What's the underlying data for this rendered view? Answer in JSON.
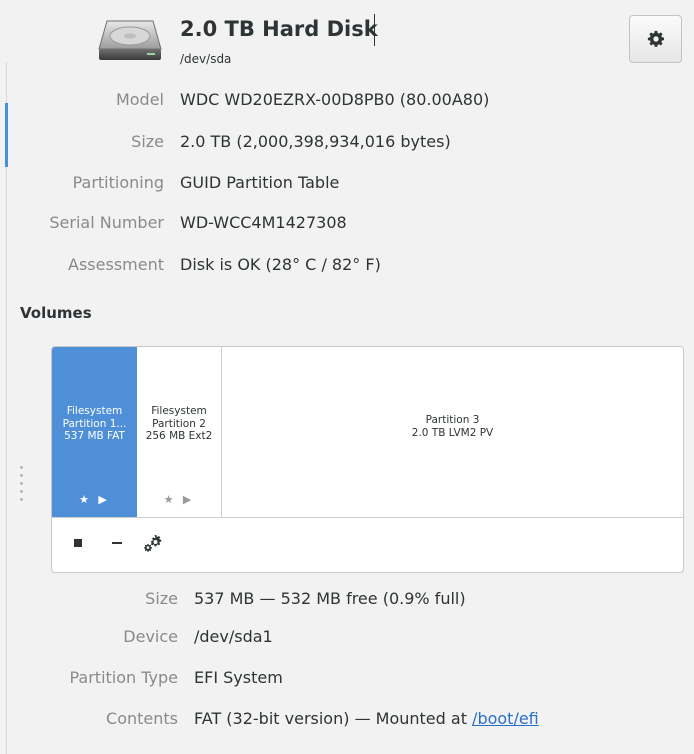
{
  "header": {
    "title": "2.0 TB Hard Disk",
    "device": "/dev/sda",
    "settings_icon": "gear-icon"
  },
  "drive_info": [
    {
      "label": "Model",
      "value": "WDC WD20EZRX-00D8PB0 (80.00A80)"
    },
    {
      "label": "Size",
      "value": "2.0 TB (2,000,398,934,016 bytes)"
    },
    {
      "label": "Partitioning",
      "value": "GUID Partition Table"
    },
    {
      "label": "Serial Number",
      "value": "WD-WCC4M1427308"
    },
    {
      "label": "Assessment",
      "value": "Disk is OK (28° C / 82° F)"
    }
  ],
  "volumes": {
    "title": "Volumes",
    "partitions": [
      {
        "line1": "Filesystem",
        "line2": "Partition 1...",
        "line3": "537 MB FAT",
        "icons": "★ ▶",
        "selected": true
      },
      {
        "line1": "Filesystem",
        "line2": "Partition 2",
        "line3": "256 MB Ext2",
        "icons": "★ ▶",
        "selected": false
      },
      {
        "line1": "Partition 3",
        "line2": "2.0 TB LVM2 PV",
        "selected": false
      }
    ],
    "toolbar": {
      "stop_icon": "stop-icon",
      "delete_icon": "minus-icon",
      "options_icon": "gears-icon"
    }
  },
  "details": [
    {
      "label": "Size",
      "value": "537 MB — 532 MB free (0.9% full)"
    },
    {
      "label": "Device",
      "value": "/dev/sda1"
    },
    {
      "label": "Partition Type",
      "value": "EFI System"
    },
    {
      "label": "Contents",
      "value": "FAT (32-bit version) — Mounted at ",
      "link": "/boot/efi"
    }
  ],
  "colors": {
    "accent": "#4f8fd8",
    "label": "#8a8a8a",
    "text": "#2e3436",
    "link": "#2a6fc9"
  }
}
